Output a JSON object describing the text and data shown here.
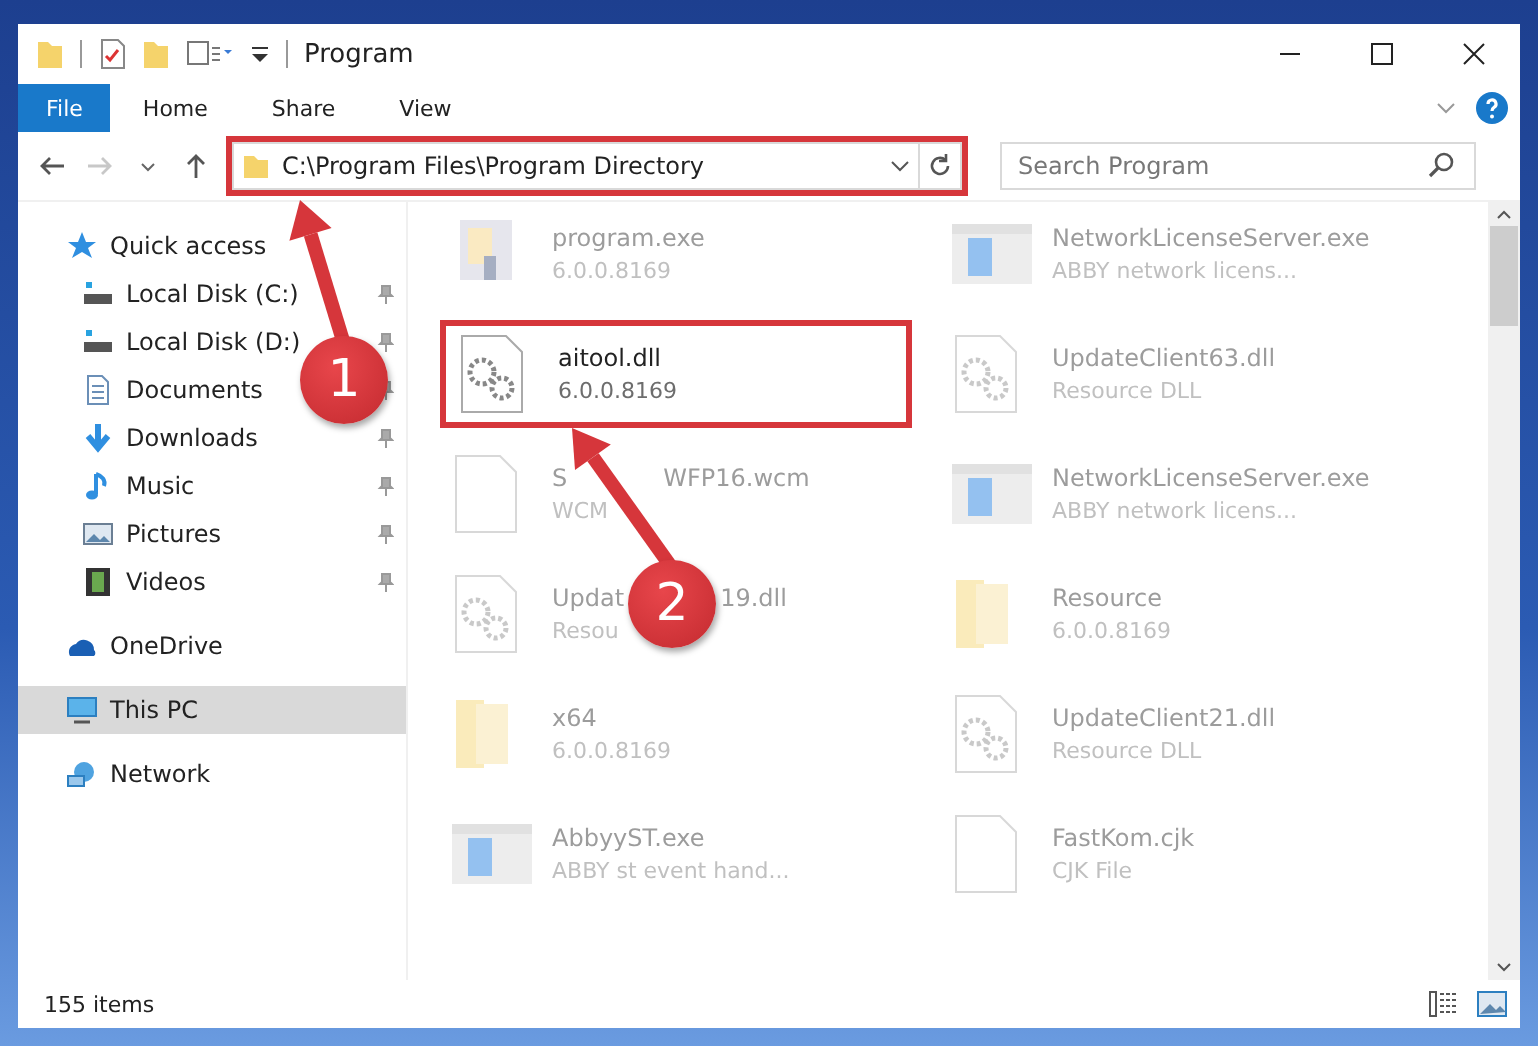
{
  "window": {
    "title": "Program"
  },
  "ribbon_tabs": [
    {
      "label": "File",
      "selected": true
    },
    {
      "label": "Home",
      "selected": false
    },
    {
      "label": "Share",
      "selected": false
    },
    {
      "label": "View",
      "selected": false
    }
  ],
  "address": {
    "path": "C:\\Program Files\\Program Directory",
    "highlighted": true
  },
  "search": {
    "placeholder": "Search Program"
  },
  "sidebar": {
    "items": [
      {
        "label": "Quick access",
        "kind": "star",
        "selected": false,
        "children": [
          {
            "label": "Local Disk (C:)",
            "kind": "drive",
            "pinned": true,
            "selected": false
          },
          {
            "label": "Local Disk (D:)",
            "kind": "drive",
            "pinned": true,
            "selected": false
          },
          {
            "label": "Documents",
            "kind": "document",
            "pinned": true,
            "selected": false
          },
          {
            "label": "Downloads",
            "kind": "download",
            "pinned": true,
            "selected": false
          },
          {
            "label": "Music",
            "kind": "music",
            "pinned": true,
            "selected": false
          },
          {
            "label": "Pictures",
            "kind": "pictures",
            "pinned": true,
            "selected": false
          },
          {
            "label": "Videos",
            "kind": "videos",
            "pinned": true,
            "selected": false
          }
        ]
      },
      {
        "label": "OneDrive",
        "kind": "cloud",
        "selected": false
      },
      {
        "label": "This PC",
        "kind": "pc",
        "selected": true
      },
      {
        "label": "Network",
        "kind": "network",
        "selected": false
      }
    ]
  },
  "files": [
    {
      "name": "program.exe",
      "detail": "6.0.0.8169",
      "kind": "installer",
      "faded": true,
      "highlighted": false
    },
    {
      "name": "NetworkLicenseServer.exe",
      "detail": "ABBY network licens...",
      "kind": "app",
      "faded": true,
      "highlighted": false
    },
    {
      "name": "aitool.dll",
      "detail": "6.0.0.8169",
      "kind": "dll",
      "faded": false,
      "highlighted": true
    },
    {
      "name": "UpdateClient63.dll",
      "detail": "Resource DLL",
      "kind": "dll",
      "faded": true,
      "highlighted": false
    },
    {
      "name": "S",
      "name_end": "WFP16.wcm",
      "detail": "WCM",
      "kind": "file",
      "faded": true,
      "highlighted": false
    },
    {
      "name": "NetworkLicenseServer.exe",
      "detail": "ABBY network licens...",
      "kind": "app",
      "faded": true,
      "highlighted": false
    },
    {
      "name": "Updat",
      "name_end": "19.dll",
      "detail": "Resou",
      "kind": "dll",
      "faded": true,
      "highlighted": false
    },
    {
      "name": "Resource",
      "detail": "6.0.0.8169",
      "kind": "folder",
      "faded": true,
      "highlighted": false
    },
    {
      "name": "x64",
      "detail": "6.0.0.8169",
      "kind": "folder",
      "faded": true,
      "highlighted": false
    },
    {
      "name": "UpdateClient21.dll",
      "detail": "Resource DLL",
      "kind": "dll",
      "faded": true,
      "highlighted": false
    },
    {
      "name": "AbbyyST.exe",
      "detail": "ABBY st event hand...",
      "kind": "app",
      "faded": true,
      "highlighted": false
    },
    {
      "name": "FastKom.cjk",
      "detail": "CJK File",
      "kind": "file",
      "faded": true,
      "highlighted": false
    }
  ],
  "status_bar": {
    "count": "155 items"
  },
  "callouts": [
    {
      "number": "1"
    },
    {
      "number": "2"
    }
  ]
}
